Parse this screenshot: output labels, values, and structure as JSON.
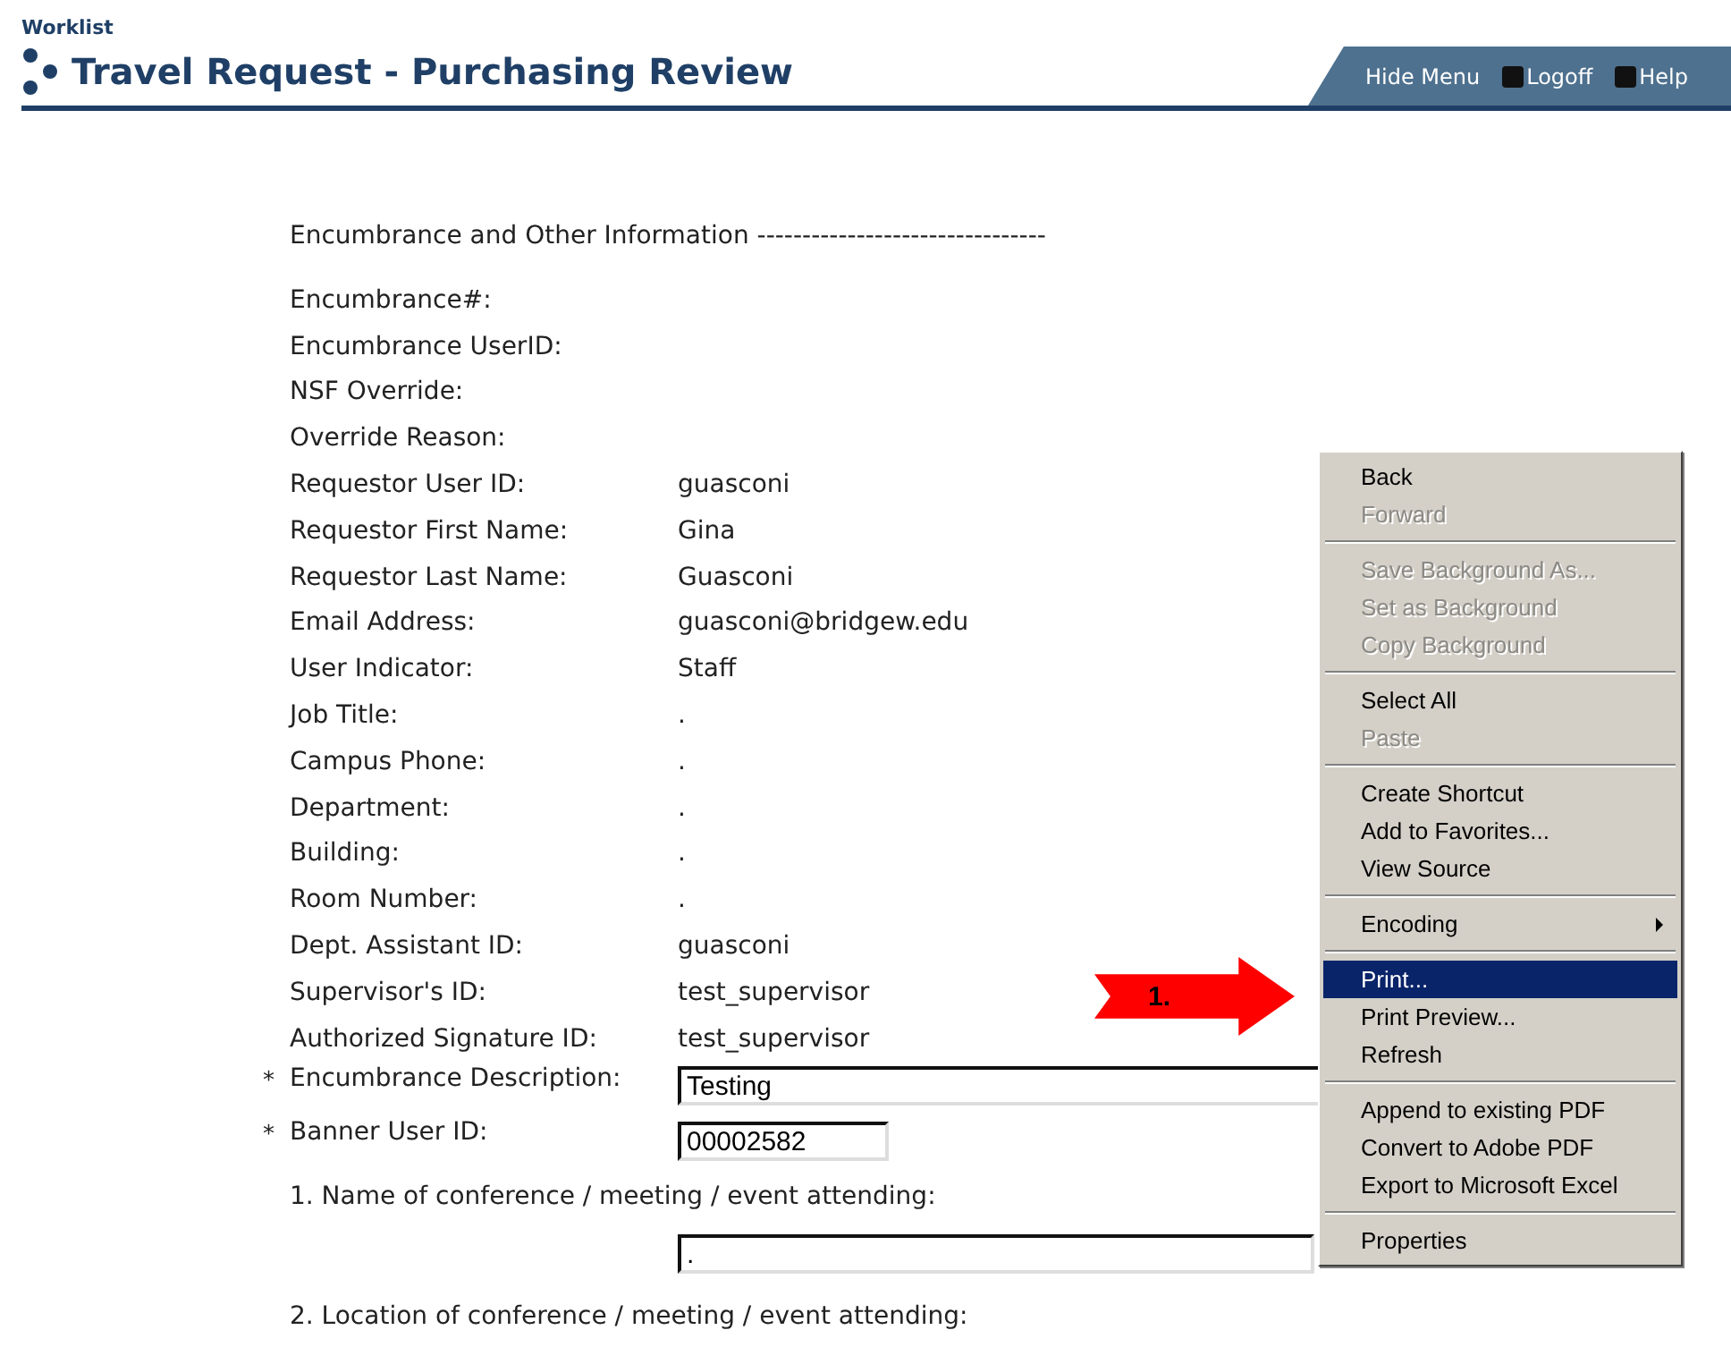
{
  "breadcrumb": "Worklist",
  "title": "Travel Request - Purchasing Review",
  "header_links": [
    {
      "label": "Hide Menu"
    },
    {
      "label": "Logoff"
    },
    {
      "label": "Help"
    }
  ],
  "section_heading": "Encumbrance and Other Information --------------------------------",
  "fields": [
    {
      "kind": "text",
      "label": "Encumbrance#:"
    },
    {
      "kind": "text",
      "label": "Encumbrance UserID:"
    },
    {
      "kind": "text",
      "label": "NSF Override:"
    },
    {
      "kind": "text",
      "label": "Override Reason:"
    },
    {
      "kind": "text",
      "label": "Requestor User ID:",
      "value": "guasconi"
    },
    {
      "kind": "text",
      "label": "Requestor First Name:",
      "value": "Gina"
    },
    {
      "kind": "text",
      "label": "Requestor Last Name:",
      "value": "Guasconi"
    },
    {
      "kind": "text",
      "label": "Email Address:",
      "value": "guasconi@bridgew.edu"
    },
    {
      "kind": "text",
      "label": "User Indicator:",
      "value": "Staff"
    },
    {
      "kind": "text",
      "label": "Job Title:",
      "value": "."
    },
    {
      "kind": "text",
      "label": "Campus Phone:",
      "value": "."
    },
    {
      "kind": "text",
      "label": "Department:",
      "value": "."
    },
    {
      "kind": "text",
      "label": "Building:",
      "value": "."
    },
    {
      "kind": "text",
      "label": "Room Number:",
      "value": "."
    },
    {
      "kind": "text",
      "label": "Dept. Assistant ID:",
      "value": "guasconi"
    },
    {
      "kind": "text",
      "label": "Supervisor's ID:",
      "value": "test_supervisor"
    },
    {
      "kind": "text",
      "label": "Authorized Signature ID:",
      "value": "test_supervisor"
    },
    {
      "kind": "input_wide",
      "marker": "*",
      "label": "Encumbrance Description:",
      "value": "Testing"
    },
    {
      "kind": "input_short",
      "marker": "*",
      "label": "Banner User ID:",
      "value": "00002582"
    },
    {
      "kind": "question",
      "label": "1. Name of conference / meeting / event attending:",
      "value": "."
    },
    {
      "kind": "question_label",
      "label": "2. Location of conference / meeting / event attending:"
    }
  ],
  "callout": {
    "label": "1."
  },
  "context_menu": [
    {
      "kind": "item",
      "label": "Back",
      "disabled": false,
      "selected": false
    },
    {
      "kind": "item",
      "label": "Forward",
      "disabled": true,
      "selected": false
    },
    {
      "kind": "separator"
    },
    {
      "kind": "item",
      "label": "Save Background As...",
      "disabled": true,
      "selected": false
    },
    {
      "kind": "item",
      "label": "Set as Background",
      "disabled": true,
      "selected": false
    },
    {
      "kind": "item",
      "label": "Copy Background",
      "disabled": true,
      "selected": false
    },
    {
      "kind": "separator"
    },
    {
      "kind": "item",
      "label": "Select All",
      "disabled": false,
      "selected": false
    },
    {
      "kind": "item",
      "label": "Paste",
      "disabled": true,
      "selected": false
    },
    {
      "kind": "separator"
    },
    {
      "kind": "item",
      "label": "Create Shortcut",
      "disabled": false,
      "selected": false
    },
    {
      "kind": "item",
      "label": "Add to Favorites...",
      "disabled": false,
      "selected": false
    },
    {
      "kind": "item",
      "label": "View Source",
      "disabled": false,
      "selected": false
    },
    {
      "kind": "separator"
    },
    {
      "kind": "submenu",
      "label": "Encoding",
      "disabled": false,
      "selected": false
    },
    {
      "kind": "separator"
    },
    {
      "kind": "item",
      "label": "Print...",
      "disabled": false,
      "selected": true
    },
    {
      "kind": "item",
      "label": "Print Preview...",
      "disabled": false,
      "selected": false
    },
    {
      "kind": "item",
      "label": "Refresh",
      "disabled": false,
      "selected": false
    },
    {
      "kind": "separator"
    },
    {
      "kind": "item",
      "label": "Append to existing PDF",
      "disabled": false,
      "selected": false
    },
    {
      "kind": "item",
      "label": "Convert to Adobe PDF",
      "disabled": false,
      "selected": false
    },
    {
      "kind": "item",
      "label": "Export to Microsoft Excel",
      "disabled": false,
      "selected": false
    },
    {
      "kind": "separator"
    },
    {
      "kind": "item",
      "label": "Properties",
      "disabled": false,
      "selected": false
    }
  ]
}
